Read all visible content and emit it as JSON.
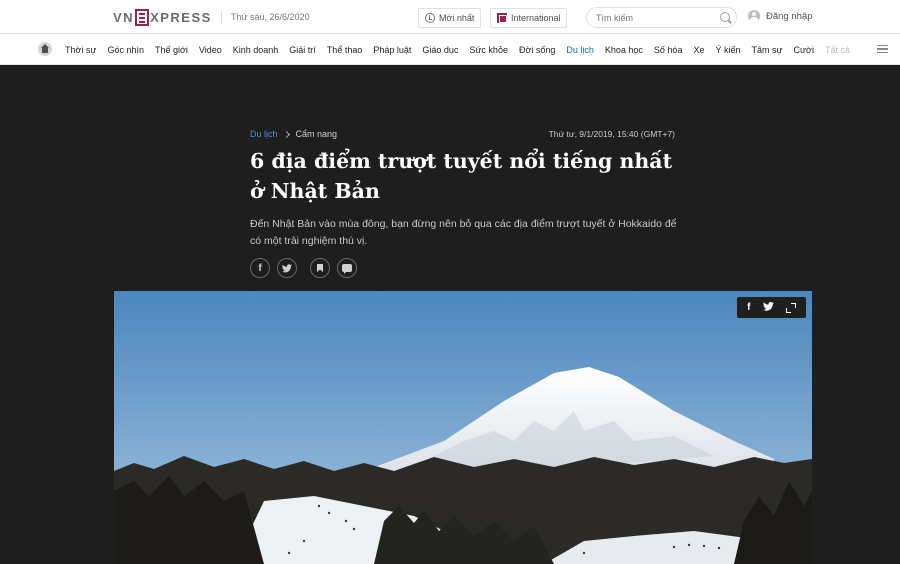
{
  "header": {
    "logo_text": "VnExpress",
    "date": "Thứ sáu, 26/6/2020",
    "latest_label": "Mới nhất",
    "international_label": "International",
    "search_placeholder": "Tìm kiếm",
    "login_label": "Đăng nhập",
    "brand_color": "#9f224e"
  },
  "nav": {
    "items": [
      {
        "label": "Thời sự"
      },
      {
        "label": "Góc nhìn"
      },
      {
        "label": "Thế giới"
      },
      {
        "label": "Video"
      },
      {
        "label": "Kinh doanh"
      },
      {
        "label": "Giải trí"
      },
      {
        "label": "Thể thao"
      },
      {
        "label": "Pháp luật"
      },
      {
        "label": "Giáo dục"
      },
      {
        "label": "Sức khỏe"
      },
      {
        "label": "Đời sống"
      },
      {
        "label": "Du lịch",
        "active": true
      },
      {
        "label": "Khoa học"
      },
      {
        "label": "Số hóa"
      },
      {
        "label": "Xe"
      },
      {
        "label": "Ý kiến"
      },
      {
        "label": "Tâm sự"
      },
      {
        "label": "Cười"
      },
      {
        "label": "Tất cả"
      }
    ],
    "active_color": "#076db6"
  },
  "article": {
    "breadcrumb": [
      "Du lịch",
      "Cẩm nang"
    ],
    "date": "Thứ tư, 9/1/2019, 15:40 (GMT+7)",
    "title": "6 địa điểm trượt tuyết nổi tiếng nhất ở Nhật Bản",
    "lead": "Đến Nhật Bản vào mùa đông, bạn đừng nên bỏ qua các địa điểm trượt tuyết ở Hokkaido để có một trải nghiệm thú vị.",
    "share_icons": [
      "facebook-icon",
      "twitter-icon",
      "bookmark-icon",
      "comment-icon"
    ]
  },
  "photo_tools": {
    "facebook_glyph": "f",
    "twitter_glyph": "🐦",
    "icons": [
      "facebook-icon",
      "twitter-icon",
      "expand-icon"
    ]
  }
}
